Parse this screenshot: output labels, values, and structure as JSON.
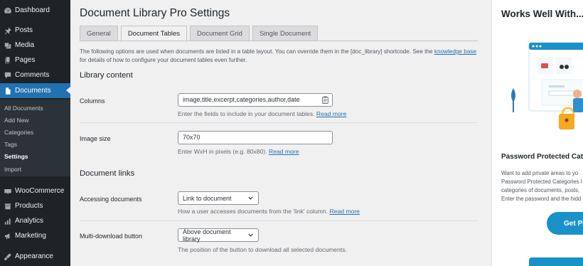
{
  "sidebar": {
    "items": [
      {
        "label": "Dashboard",
        "icon": "dashboard-icon"
      },
      {
        "label": "Posts",
        "icon": "pin-icon"
      },
      {
        "label": "Media",
        "icon": "media-icon"
      },
      {
        "label": "Pages",
        "icon": "pages-icon"
      },
      {
        "label": "Comments",
        "icon": "comments-icon"
      },
      {
        "label": "Documents",
        "icon": "documents-icon"
      },
      {
        "label": "WooCommerce",
        "icon": "woocommerce-icon"
      },
      {
        "label": "Products",
        "icon": "products-icon"
      },
      {
        "label": "Analytics",
        "icon": "analytics-icon"
      },
      {
        "label": "Marketing",
        "icon": "marketing-icon"
      },
      {
        "label": "Appearance",
        "icon": "appearance-icon"
      }
    ],
    "submenu": [
      "All Documents",
      "Add New",
      "Categories",
      "Tags",
      "Settings",
      "Import"
    ]
  },
  "main": {
    "title": "Document Library Pro Settings",
    "tabs": [
      "General",
      "Document Tables",
      "Document Grid",
      "Single Document"
    ],
    "intro": {
      "line1": "The following options are used when documents are listed in a table layout. You can override them in the [doc_library] shortcode. See the ",
      "link": "knowledge base",
      "line2": "for details of how to configure your document tables even further."
    },
    "library_content": {
      "title": "Library content",
      "columns_label": "Columns",
      "columns_value": "image,title,excerpt,categories,author,date",
      "columns_desc": "Enter the fields to include in your document tables.",
      "columns_link": "Read more",
      "image_size_label": "Image size",
      "image_size_value": "70x70",
      "image_size_desc": "Enter WxH in pixels (e.g. 80x80).",
      "image_size_link": "Read more"
    },
    "document_links": {
      "title": "Document links",
      "accessing_label": "Accessing documents",
      "accessing_value": "Link to document",
      "accessing_desc": "How a user accesses documents from the 'link' column.",
      "accessing_link": "Read more",
      "multi_label": "Multi-download button",
      "multi_value": "Above document library",
      "multi_desc": "The position of the button to download all selected documents."
    }
  },
  "promo": {
    "title": "Works Well With...",
    "heading": "Password Protected Cate",
    "lines": [
      "Want to add private areas to yo",
      "Password Protected Categories l",
      "categories of documents, posts,",
      "Enter the password and the hidd"
    ],
    "button": "Get Pl"
  },
  "colors": {
    "sidebar_bg": "#1d2327",
    "accent": "#2271b1",
    "promo_button": "#1a91c9"
  }
}
